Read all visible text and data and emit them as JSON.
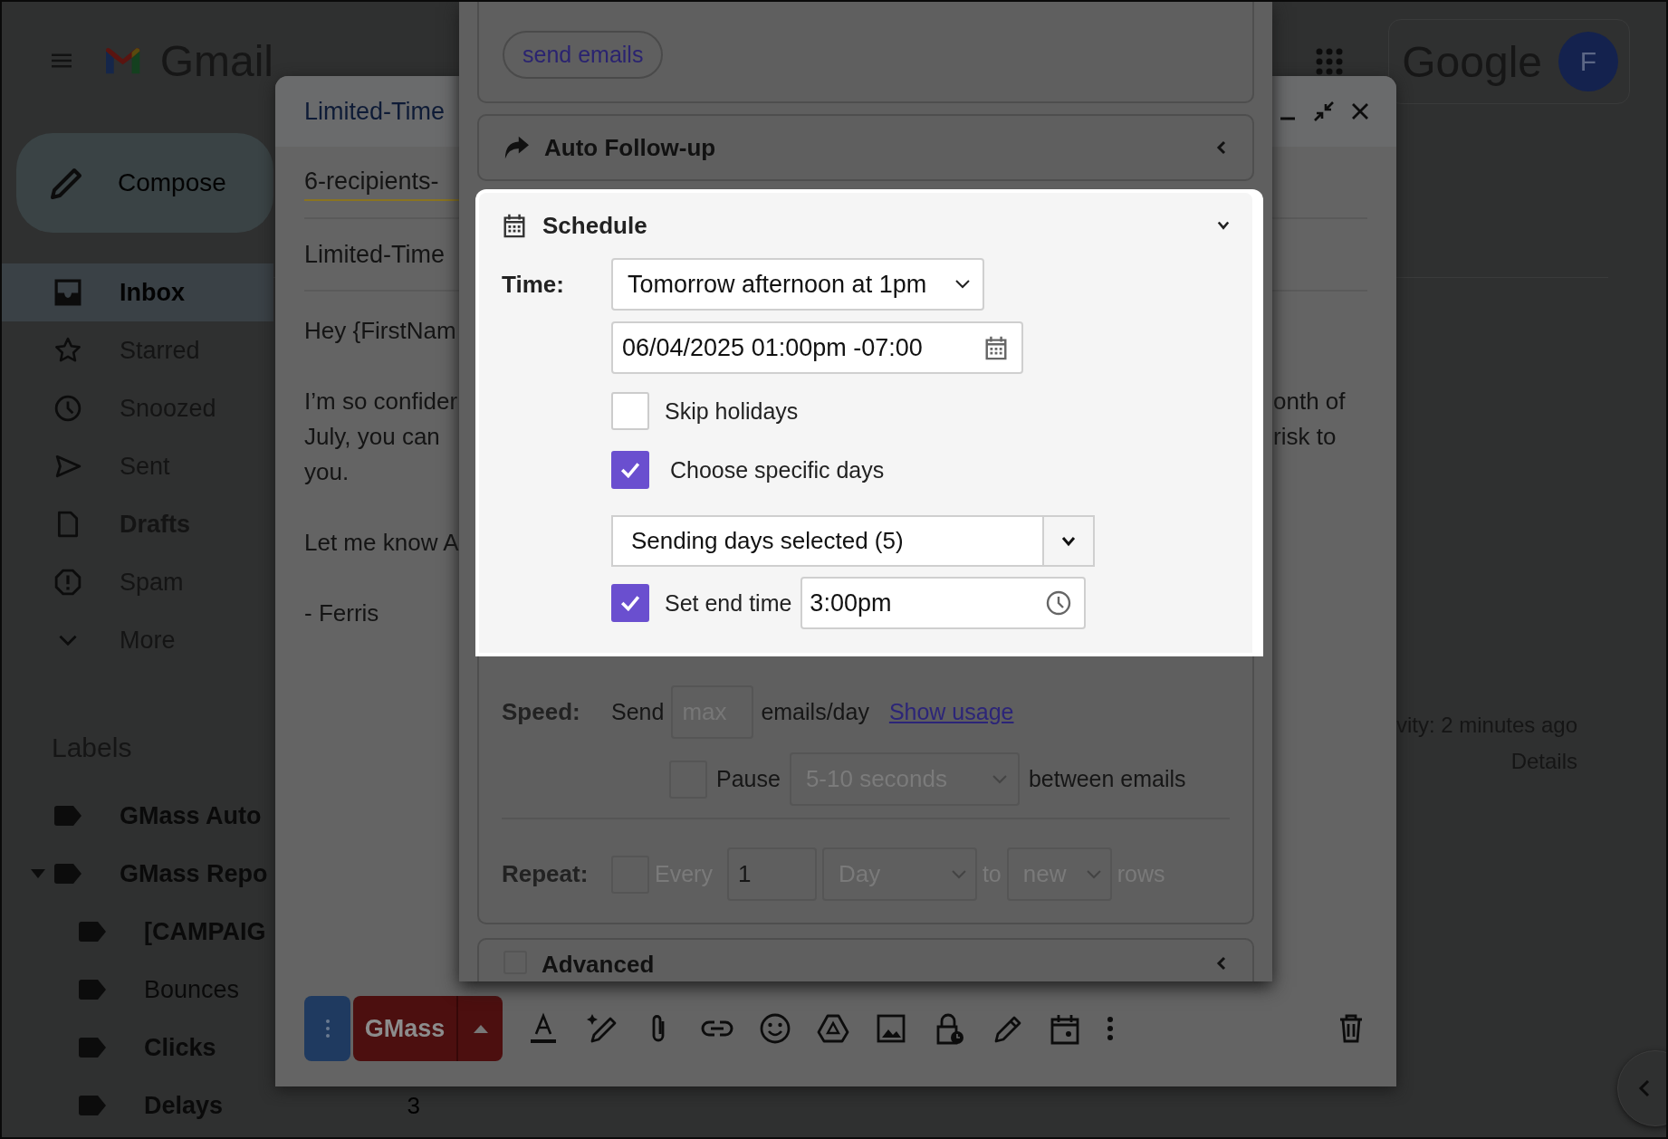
{
  "gmail": {
    "app_name": "Gmail",
    "compose": "Compose",
    "nav": [
      {
        "label": "Inbox",
        "selected": true,
        "unread": true
      },
      {
        "label": "Starred",
        "selected": false,
        "unread": false
      },
      {
        "label": "Snoozed",
        "selected": false,
        "unread": false
      },
      {
        "label": "Sent",
        "selected": false,
        "unread": false
      },
      {
        "label": "Drafts",
        "selected": false,
        "unread": true
      },
      {
        "label": "Spam",
        "selected": false,
        "unread": false
      },
      {
        "label": "More",
        "selected": false,
        "unread": false
      }
    ],
    "labels_heading": "Labels",
    "labels": [
      {
        "label": "GMass Auto",
        "unread": true
      },
      {
        "label": "GMass Repo",
        "unread": true,
        "expanded": true,
        "children": [
          {
            "label": "[CAMPAIG",
            "unread": true
          },
          {
            "label": "Bounces",
            "unread": false
          },
          {
            "label": "Clicks",
            "unread": true
          },
          {
            "label": "Delays",
            "unread": true,
            "count": "3"
          }
        ]
      }
    ],
    "account_text": "Google",
    "avatar": "F",
    "activity": "vity: 2 minutes ago",
    "details": "Details"
  },
  "compose": {
    "title": "Limited-Time",
    "recipients": "6-recipients-",
    "subject": "Limited-Time",
    "body": [
      [
        {
          "text": "Hey {FirstNam"
        }
      ],
      [
        {
          "text": "I’m so confider",
          "right": "onth of"
        },
        {
          "text": "July, you can",
          "right": "risk to"
        },
        {
          "text": "you."
        }
      ],
      [
        {
          "text": "Let me know A"
        }
      ],
      [
        {
          "text": "- Ferris"
        }
      ]
    ],
    "send_label": "GMass"
  },
  "panel": {
    "top_button": "send emails",
    "auto_followup": {
      "title": "Auto Follow-up",
      "expanded": false
    },
    "schedule": {
      "title": "Schedule",
      "expanded": true,
      "time_label": "Time:",
      "time_select": "Tomorrow afternoon at 1pm",
      "datetime": "06/04/2025 01:00pm -07:00",
      "options": [
        {
          "label": "Skip holidays",
          "checked": false
        },
        {
          "label": "Choose specific days",
          "checked": true
        }
      ],
      "days_select": "Sending days selected (5)",
      "end_time": {
        "label": "Set end time",
        "checked": true,
        "value": "3:00pm"
      },
      "speed": {
        "label": "Speed:",
        "send": "Send",
        "placeholder": "max",
        "unit": "emails/day",
        "link": "Show usage",
        "pause": {
          "checked": false,
          "label": "Pause",
          "select": "5-10 seconds",
          "suffix": "between emails"
        }
      },
      "repeat": {
        "label": "Repeat:",
        "checked": false,
        "every": "Every",
        "count": "1",
        "unit": "Day",
        "to": "to",
        "target": "new",
        "suffix": "rows"
      }
    },
    "advanced": {
      "title": "Advanced",
      "checked": false,
      "expanded": false
    }
  }
}
